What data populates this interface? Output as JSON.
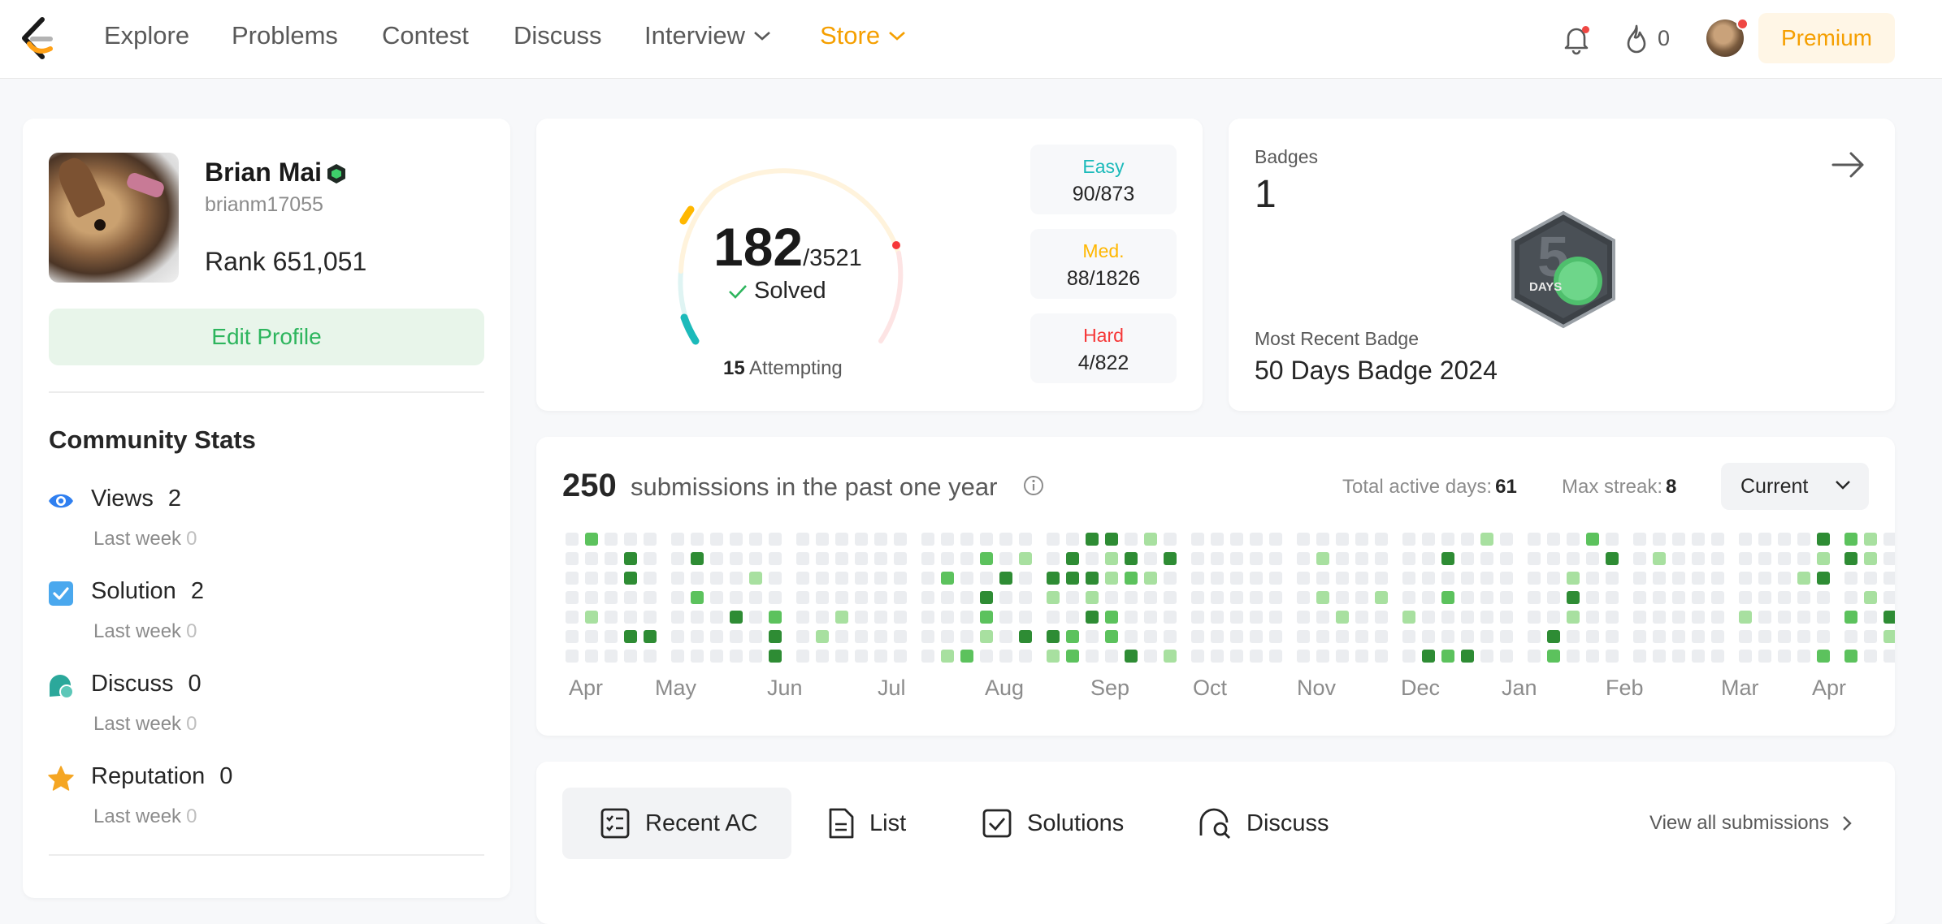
{
  "nav": {
    "items": [
      "Explore",
      "Problems",
      "Contest",
      "Discuss",
      "Interview",
      "Store"
    ],
    "flame_count": "0",
    "premium_label": "Premium"
  },
  "profile": {
    "name": "Brian Mai",
    "handle": "brianm17055",
    "rank_label": "Rank",
    "rank_value": "651,051",
    "edit_label": "Edit Profile"
  },
  "community": {
    "title": "Community Stats",
    "stats": [
      {
        "label": "Views",
        "value": "2",
        "sub_label": "Last week",
        "sub_value": "0",
        "icon": "eye-icon",
        "color": "#2f7ff0"
      },
      {
        "label": "Solution",
        "value": "2",
        "sub_label": "Last week",
        "sub_value": "0",
        "icon": "solution-check-icon",
        "color": "#4aa8ee"
      },
      {
        "label": "Discuss",
        "value": "0",
        "sub_label": "Last week",
        "sub_value": "0",
        "icon": "discuss-bubble-icon",
        "color": "#2ba89b"
      },
      {
        "label": "Reputation",
        "value": "0",
        "sub_label": "Last week",
        "sub_value": "0",
        "icon": "star-icon",
        "color": "#f5a623"
      }
    ]
  },
  "solved": {
    "count": "182",
    "total": "/3521",
    "label": "Solved",
    "attempting_count": "15",
    "attempting_label": "Attempting",
    "difficulties": [
      {
        "name": "Easy",
        "value": "90/873",
        "color": "#1cbaba"
      },
      {
        "name": "Med.",
        "value": "88/1826",
        "color": "#ffb700"
      },
      {
        "name": "Hard",
        "value": "4/822",
        "color": "#f63737"
      }
    ]
  },
  "badges": {
    "title": "Badges",
    "count": "1",
    "badge_text": "DAYS",
    "recent_label": "Most Recent Badge",
    "recent_name": "50 Days Badge 2024"
  },
  "submissions": {
    "count": "250",
    "text": "submissions in the past one year",
    "active_label": "Total active days:",
    "active_value": "61",
    "streak_label": "Max streak:",
    "streak_value": "8",
    "select_value": "Current",
    "months": [
      "Apr",
      "May",
      "Jun",
      "Jul",
      "Aug",
      "Sep",
      "Oct",
      "Nov",
      "Dec",
      "Jan",
      "Feb",
      "Mar",
      "Apr"
    ]
  },
  "tabs": {
    "items": [
      {
        "label": "Recent AC",
        "icon": "checklist-icon"
      },
      {
        "label": "List",
        "icon": "document-icon"
      },
      {
        "label": "Solutions",
        "icon": "checkbox-icon"
      },
      {
        "label": "Discuss",
        "icon": "discuss-search-icon"
      }
    ],
    "view_all": "View all submissions"
  }
}
